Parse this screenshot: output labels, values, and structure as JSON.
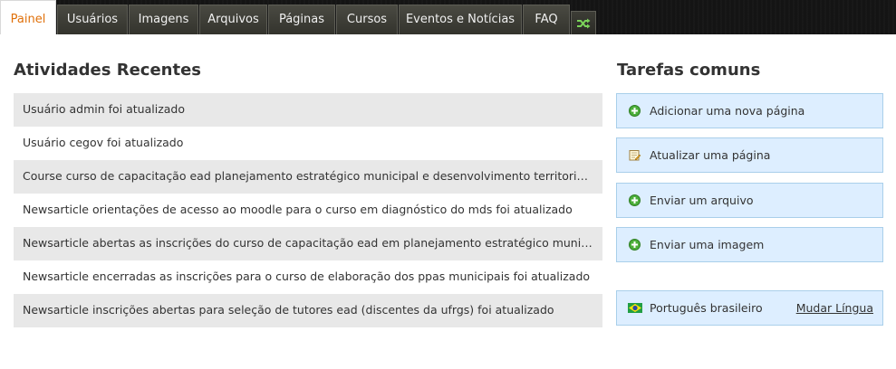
{
  "nav": {
    "tabs": [
      "Painel",
      "Usuários",
      "Imagens",
      "Arquivos",
      "Páginas",
      "Cursos",
      "Eventos e Notícias",
      "FAQ"
    ],
    "active_tab": "Painel",
    "extra_icon": "shuffle-icon"
  },
  "activities": {
    "title": "Atividades Recentes",
    "items": [
      "Usuário admin foi atualizado",
      "Usuário cegov foi atualizado",
      "Course curso de capacitação ead planejamento estratégico municipal e desenvolvimento territorial - módul...",
      "Newsarticle orientações de acesso ao moodle para o curso em diagnóstico do mds foi atualizado",
      "Newsarticle abertas as inscrições do curso de capacitação ead em planejamento estratégico municipal e ...",
      "Newsarticle encerradas as inscrições para o curso de elaboração dos ppas municipais foi atualizado",
      "Newsarticle inscrições abertas para seleção de tutores ead (discentes da ufrgs) foi atualizado"
    ]
  },
  "tasks": {
    "title": "Tarefas comuns",
    "items": [
      {
        "label": "Adicionar uma nova página",
        "icon": "add-icon"
      },
      {
        "label": "Atualizar uma página",
        "icon": "edit-page-icon"
      },
      {
        "label": "Enviar um arquivo",
        "icon": "add-icon"
      },
      {
        "label": "Enviar uma imagem",
        "icon": "add-icon"
      }
    ],
    "language": {
      "label": "Português brasileiro",
      "icon": "brazil-flag-icon",
      "change_label": "Mudar Língua"
    }
  },
  "colors": {
    "accent_orange": "#e0700a",
    "task_bg": "#ddeeff",
    "task_border": "#a9cfea",
    "row_shade": "#e8e8e8",
    "nav_bg": "#141414"
  }
}
